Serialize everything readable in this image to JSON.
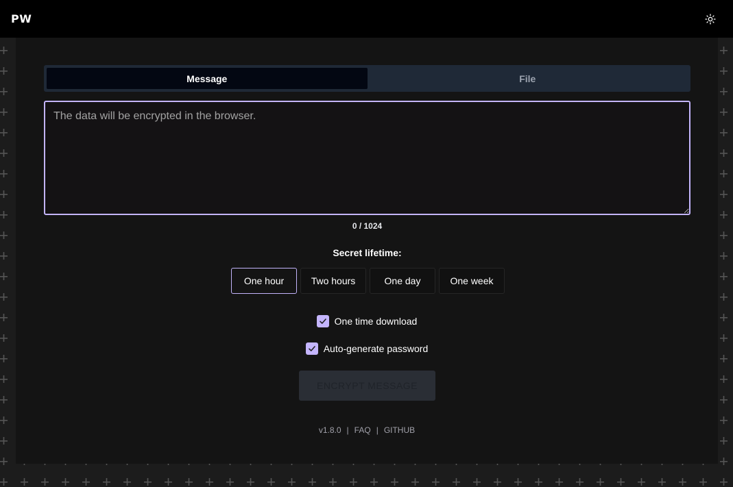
{
  "header": {
    "logo": "PW",
    "theme_icon": "sun-icon"
  },
  "tabs": [
    {
      "label": "Message",
      "active": true
    },
    {
      "label": "File",
      "active": false
    }
  ],
  "message": {
    "placeholder": "The data will be encrypted in the browser.",
    "value": "",
    "counter": "0 / 1024"
  },
  "lifetime": {
    "label": "Secret lifetime:",
    "options": [
      {
        "label": "One hour",
        "selected": true
      },
      {
        "label": "Two hours",
        "selected": false
      },
      {
        "label": "One day",
        "selected": false
      },
      {
        "label": "One week",
        "selected": false
      }
    ]
  },
  "options": {
    "one_time_download": {
      "label": "One time download",
      "checked": true
    },
    "auto_password": {
      "label": "Auto-generate password",
      "checked": true
    }
  },
  "encrypt_button": "ENCRYPT MESSAGE",
  "footer": {
    "version": "v1.8.0",
    "separator": "|",
    "faq": "FAQ",
    "github": "GITHUB"
  },
  "colors": {
    "accent": "#c4b5fd",
    "header_bg": "#000000",
    "panel_bg": "#141414"
  }
}
